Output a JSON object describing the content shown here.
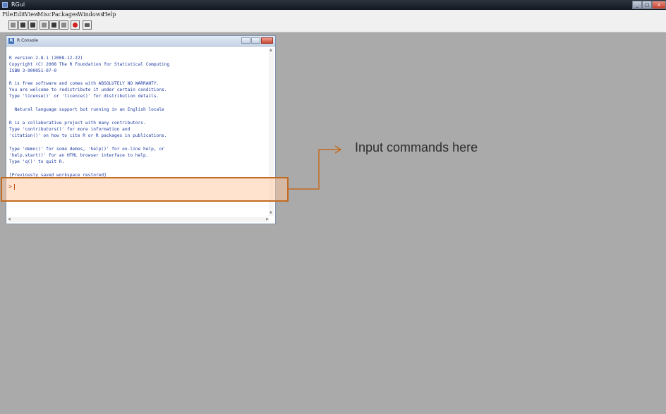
{
  "window": {
    "title": "RGui",
    "controls": [
      "_",
      "□",
      "×"
    ]
  },
  "menubar": {
    "items": [
      "File",
      "Edit",
      "View",
      "Misc",
      "Packages",
      "Windows",
      "Help"
    ]
  },
  "toolbar": {
    "buttons": [
      "open-script-icon",
      "load-workspace-icon",
      "save-workspace-icon",
      "copy-icon",
      "paste-icon",
      "copy-paste-icon",
      "stop-icon",
      "print-icon"
    ]
  },
  "console": {
    "title": "R Console",
    "lines": [
      "R version 2.8.1 (2008-12-22)",
      "Copyright (C) 2008 The R Foundation for Statistical Computing",
      "ISBN 3-900051-07-0",
      "R is free software and comes with ABSOLUTELY NO WARRANTY.",
      "You are welcome to redistribute it under certain conditions.",
      "Type 'license()' or 'licence()' for distribution details.",
      "  Natural language support but running in an English locale",
      "R is a collaborative project with many contributors.",
      "Type 'contributors()' for more information and",
      "'citation()' on how to cite R or R packages in publications.",
      "Type 'demo()' for some demos, 'help()' for on-line help, or",
      "'help.start()' for an HTML browser interface to help.",
      "Type 'q()' to quit R.",
      "[Previously saved workspace restored]"
    ],
    "prompt": ">"
  },
  "annotation": {
    "text": "Input commands here"
  },
  "colors": {
    "highlight_border": "#c36b21",
    "console_text": "#1f3aa0",
    "mdi_background": "#aaaaaa"
  }
}
